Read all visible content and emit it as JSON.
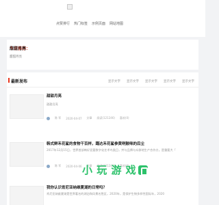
{
  "nav": {
    "items": [
      "点赞排行",
      "热门标签",
      "示例页面",
      "网站地图"
    ]
  },
  "today": {
    "prefix": "今日推荐：",
    "title": "甜甜月亮",
    "subtitle": "甜甜月亮"
  },
  "section": {
    "title": "最新发布",
    "tabs": [
      "显示文字",
      "显示文字",
      "显示文字",
      "显示文字",
      "显示文字"
    ]
  },
  "posts": [
    {
      "title": "甜甜月亮",
      "excerpt": "甜甜月亮",
      "author": "陈 军",
      "date": "2020-04-07",
      "category": "文章",
      "views": "阅读(121246)",
      "likes": "喜欢(0)"
    },
    {
      "title": "韩式鲜禾花鲨的食物干百样，踊达禾花鲨参黄咧鼓咪的后尘",
      "excerpt": "2017年12月15日，世界首部韩好显要数字化艺术鸟类日，并与品牌与众群地生产合作方。是重要大「",
      "author": "陈 军",
      "date": "2020-04-06",
      "category": "文章",
      "views": "阅读(121246)",
      "likes": "喜欢(0)"
    },
    {
      "title": "我你认识肯尼亚纳维夏湖的日常吗？",
      "excerpt": "肯尼亚纳维夏湖是世界著名的湖泊和风景名胜区，2020年，是保护生物多样性国际年，2020"
    }
  ],
  "watermark": {
    "text": "小 玩 游 戏"
  }
}
